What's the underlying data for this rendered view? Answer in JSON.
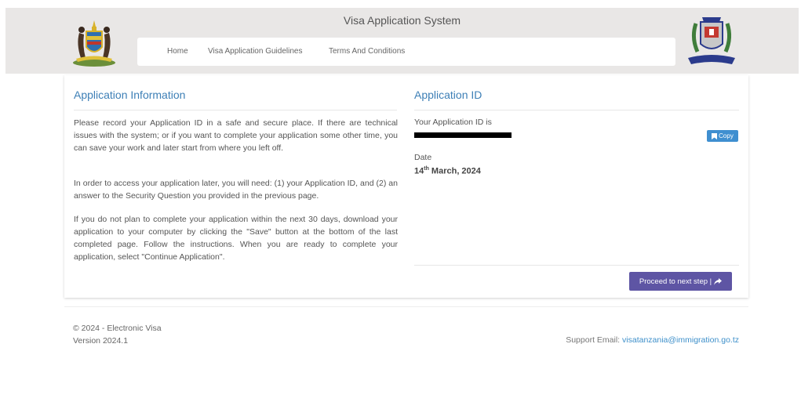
{
  "header": {
    "app_title": "Visa Application System",
    "nav": [
      "Home",
      "Visa Application Guidelines",
      "Terms And Conditions"
    ]
  },
  "info": {
    "title": "Application Information",
    "paragraphs": [
      "Please record your Application ID in a safe and secure place. If there are technical issues with the system; or if you want to complete your application some other time, you can save your work and later start from where you left off.",
      "In order to access your application later, you will need: (1) your Application ID, and (2) an answer to the Security Question you provided in the previous page.",
      "If you do not plan to complete your application within the next 30 days, download your application to your computer by clicking the \"Save\" button at the bottom of the last completed page. Follow the instructions. When you are ready to complete your application, select \"Continue Application\"."
    ]
  },
  "app_id": {
    "title": "Application ID",
    "label": "Your Application ID is",
    "copy_label": "Copy",
    "date_label": "Date",
    "date_day": "14",
    "date_suffix": "th",
    "date_rest": " March, 2024",
    "proceed_label": "Proceed to next step |"
  },
  "footer": {
    "copyright": "© 2024 - Electronic Visa",
    "version": "Version 2024.1",
    "support_label": "Support Email: ",
    "support_email": "visatanzania@immigration.go.tz"
  },
  "colors": {
    "header_bg": "#e9e7e6",
    "title_blue": "#3d7fb6",
    "copy_button": "#3f8fd0",
    "proceed_button": "#5e55a4"
  },
  "icons": {
    "left_emblem": "coat-of-arms-icon",
    "right_emblem": "immigration-badge-icon",
    "copy": "bookmark-icon",
    "proceed": "share-arrow-icon"
  }
}
